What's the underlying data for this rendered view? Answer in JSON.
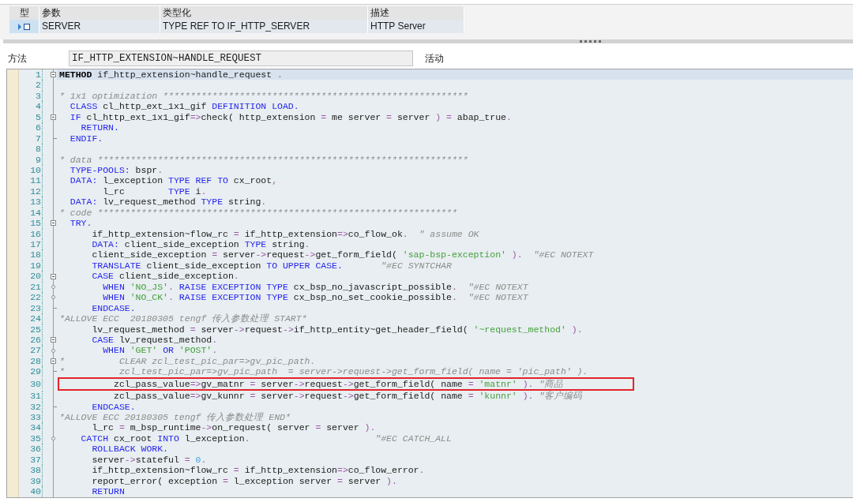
{
  "parameter_table": {
    "columns": [
      "型",
      "参数",
      "类型化",
      "描述"
    ],
    "rows": [
      {
        "parameter": "SERVER",
        "typing": "TYPE REF TO IF_HTTP_SERVER",
        "description": "HTTP Server"
      }
    ]
  },
  "method_bar": {
    "label": "方法",
    "value": "IF_HTTP_EXTENSION~HANDLE_REQUEST",
    "status": "活动"
  },
  "editor": {
    "lines": [
      {
        "number": "1",
        "kind": "opener",
        "selected": true,
        "boxed": false,
        "tokens": [
          {
            "kind": "bold",
            "text": "METHOD"
          },
          {
            "kind": "plain",
            "text": " if_http_extension~handle_request "
          },
          {
            "kind": "op",
            "text": "."
          }
        ]
      },
      {
        "number": "2",
        "kind": "line",
        "selected": false,
        "boxed": false
      },
      {
        "number": "3",
        "kind": "line",
        "selected": false,
        "boxed": false,
        "tokens": [
          {
            "kind": "comment",
            "text": "* 1x1 optimization ********************************************************"
          }
        ]
      },
      {
        "number": "4",
        "kind": "line",
        "selected": false,
        "boxed": false,
        "tokens": [
          {
            "kind": "keyword",
            "text": "  CLASS"
          },
          {
            "kind": "plain",
            "text": " cl_http_ext_1x1_gif "
          },
          {
            "kind": "keyword",
            "text": "DEFINITION LOAD."
          }
        ]
      },
      {
        "number": "5",
        "kind": "opener",
        "selected": false,
        "boxed": false,
        "tokens": [
          {
            "kind": "keyword",
            "text": "  IF"
          },
          {
            "kind": "plain",
            "text": " cl_http_ext_1x1_gif"
          },
          {
            "kind": "op",
            "text": "=>"
          },
          {
            "kind": "plain",
            "text": "check( http_extension "
          },
          {
            "kind": "op",
            "text": "="
          },
          {
            "kind": "plain",
            "text": " me server "
          },
          {
            "kind": "op",
            "text": "="
          },
          {
            "kind": "plain",
            "text": " server "
          },
          {
            "kind": "op",
            "text": ") ="
          },
          {
            "kind": "plain",
            "text": " abap_true"
          },
          {
            "kind": "op",
            "text": "."
          }
        ]
      },
      {
        "number": "6",
        "kind": "line",
        "selected": false,
        "boxed": false,
        "tokens": [
          {
            "kind": "keyword",
            "text": "    RETURN."
          }
        ]
      },
      {
        "number": "7",
        "kind": "closer",
        "selected": false,
        "boxed": false,
        "tokens": [
          {
            "kind": "keyword",
            "text": "  ENDIF."
          }
        ]
      },
      {
        "number": "8",
        "kind": "line",
        "selected": false,
        "boxed": false
      },
      {
        "number": "9",
        "kind": "line",
        "selected": false,
        "boxed": false,
        "tokens": [
          {
            "kind": "comment",
            "text": "* data ********************************************************************"
          }
        ]
      },
      {
        "number": "10",
        "kind": "line",
        "selected": false,
        "boxed": false,
        "tokens": [
          {
            "kind": "keyword",
            "text": "  TYPE-POOLS:"
          },
          {
            "kind": "plain",
            "text": " bspr"
          },
          {
            "kind": "op",
            "text": "."
          }
        ]
      },
      {
        "number": "11",
        "kind": "line",
        "selected": false,
        "boxed": false,
        "tokens": [
          {
            "kind": "keyword",
            "text": "  DATA:"
          },
          {
            "kind": "plain",
            "text": " l_exception "
          },
          {
            "kind": "keyword",
            "text": "TYPE REF TO"
          },
          {
            "kind": "plain",
            "text": " cx_root"
          },
          {
            "kind": "op",
            "text": ","
          }
        ]
      },
      {
        "number": "12",
        "kind": "line",
        "selected": false,
        "boxed": false,
        "tokens": [
          {
            "kind": "plain",
            "text": "        l_rc        "
          },
          {
            "kind": "keyword",
            "text": "TYPE"
          },
          {
            "kind": "plain",
            "text": " i"
          },
          {
            "kind": "op",
            "text": "."
          }
        ]
      },
      {
        "number": "13",
        "kind": "line",
        "selected": false,
        "boxed": false,
        "tokens": [
          {
            "kind": "keyword",
            "text": "  DATA:"
          },
          {
            "kind": "plain",
            "text": " lv_request_method "
          },
          {
            "kind": "keyword",
            "text": "TYPE"
          },
          {
            "kind": "plain",
            "text": " string"
          },
          {
            "kind": "op",
            "text": "."
          }
        ]
      },
      {
        "number": "14",
        "kind": "line",
        "selected": false,
        "boxed": false,
        "tokens": [
          {
            "kind": "comment",
            "text": "* code ******************************************************************"
          }
        ]
      },
      {
        "number": "15",
        "kind": "opener",
        "selected": false,
        "boxed": false,
        "tokens": [
          {
            "kind": "keyword",
            "text": "  TRY."
          }
        ]
      },
      {
        "number": "16",
        "kind": "line",
        "selected": false,
        "boxed": false,
        "tokens": [
          {
            "kind": "plain",
            "text": "      if_http_extension~flow_rc "
          },
          {
            "kind": "op",
            "text": "="
          },
          {
            "kind": "plain",
            "text": " if_http_extension"
          },
          {
            "kind": "op",
            "text": "=>"
          },
          {
            "kind": "plain",
            "text": "co_flow_ok"
          },
          {
            "kind": "op",
            "text": "."
          },
          {
            "kind": "comment",
            "text": "  \" assume OK"
          }
        ]
      },
      {
        "number": "17",
        "kind": "line",
        "selected": false,
        "boxed": false,
        "tokens": [
          {
            "kind": "keyword",
            "text": "      DATA:"
          },
          {
            "kind": "plain",
            "text": " client_side_exception "
          },
          {
            "kind": "keyword",
            "text": "TYPE"
          },
          {
            "kind": "plain",
            "text": " string"
          },
          {
            "kind": "op",
            "text": "."
          }
        ]
      },
      {
        "number": "18",
        "kind": "line",
        "selected": false,
        "boxed": false,
        "tokens": [
          {
            "kind": "plain",
            "text": "      client_side_exception "
          },
          {
            "kind": "op",
            "text": "="
          },
          {
            "kind": "plain",
            "text": " server"
          },
          {
            "kind": "op",
            "text": "->"
          },
          {
            "kind": "plain",
            "text": "request"
          },
          {
            "kind": "op",
            "text": "->"
          },
          {
            "kind": "plain",
            "text": "get_form_field( "
          },
          {
            "kind": "string",
            "text": "'sap-bsp-exception'"
          },
          {
            "kind": "op",
            "text": " )."
          },
          {
            "kind": "comment",
            "text": "  \"#EC NOTEXT"
          }
        ]
      },
      {
        "number": "19",
        "kind": "line",
        "selected": false,
        "boxed": false,
        "tokens": [
          {
            "kind": "keyword",
            "text": "      TRANSLATE"
          },
          {
            "kind": "plain",
            "text": " client_side_exception "
          },
          {
            "kind": "keyword",
            "text": "TO UPPER CASE."
          },
          {
            "kind": "comment",
            "text": "       \"#EC SYNTCHAR"
          }
        ]
      },
      {
        "number": "20",
        "kind": "opener",
        "selected": false,
        "boxed": false,
        "tokens": [
          {
            "kind": "keyword",
            "text": "      CASE"
          },
          {
            "kind": "plain",
            "text": " client_side_exception"
          },
          {
            "kind": "op",
            "text": "."
          }
        ]
      },
      {
        "number": "21",
        "kind": "branch",
        "selected": false,
        "boxed": false,
        "tokens": [
          {
            "kind": "keyword",
            "text": "        WHEN"
          },
          {
            "kind": "string",
            "text": " 'NO_JS'"
          },
          {
            "kind": "op",
            "text": "."
          },
          {
            "kind": "keyword",
            "text": " RAISE EXCEPTION TYPE"
          },
          {
            "kind": "plain",
            "text": " cx_bsp_no_javascript_possible"
          },
          {
            "kind": "op",
            "text": "."
          },
          {
            "kind": "comment",
            "text": "  \"#EC NOTEXT"
          }
        ]
      },
      {
        "number": "22",
        "kind": "branch",
        "selected": false,
        "boxed": false,
        "tokens": [
          {
            "kind": "keyword",
            "text": "        WHEN"
          },
          {
            "kind": "string",
            "text": " 'NO_CK'"
          },
          {
            "kind": "op",
            "text": "."
          },
          {
            "kind": "keyword",
            "text": " RAISE EXCEPTION TYPE"
          },
          {
            "kind": "plain",
            "text": " cx_bsp_no_set_cookie_possible"
          },
          {
            "kind": "op",
            "text": "."
          },
          {
            "kind": "comment",
            "text": "  \"#EC NOTEXT"
          }
        ]
      },
      {
        "number": "23",
        "kind": "closer",
        "selected": false,
        "boxed": false,
        "tokens": [
          {
            "kind": "keyword",
            "text": "      ENDCASE."
          }
        ]
      },
      {
        "number": "24",
        "kind": "line",
        "selected": false,
        "boxed": false,
        "tokens": [
          {
            "kind": "comment",
            "text": "*ALLOVE ECC  20180305 tengf 传入参数处理 START*"
          }
        ]
      },
      {
        "number": "25",
        "kind": "line",
        "selected": false,
        "boxed": false,
        "tokens": [
          {
            "kind": "plain",
            "text": "      lv_request_method "
          },
          {
            "kind": "op",
            "text": "="
          },
          {
            "kind": "plain",
            "text": " server"
          },
          {
            "kind": "op",
            "text": "->"
          },
          {
            "kind": "plain",
            "text": "request"
          },
          {
            "kind": "op",
            "text": "->"
          },
          {
            "kind": "plain",
            "text": "if_http_entity~get_header_field( "
          },
          {
            "kind": "string",
            "text": "'~request_method'"
          },
          {
            "kind": "op",
            "text": " )."
          }
        ]
      },
      {
        "number": "26",
        "kind": "opener",
        "selected": false,
        "boxed": false,
        "tokens": [
          {
            "kind": "keyword",
            "text": "      CASE"
          },
          {
            "kind": "plain",
            "text": " lv_request_method"
          },
          {
            "kind": "op",
            "text": "."
          }
        ]
      },
      {
        "number": "27",
        "kind": "branch",
        "selected": false,
        "boxed": false,
        "tokens": [
          {
            "kind": "keyword",
            "text": "        WHEN"
          },
          {
            "kind": "string",
            "text": " 'GET'"
          },
          {
            "kind": "keyword",
            "text": " OR"
          },
          {
            "kind": "string",
            "text": " 'POST'"
          },
          {
            "kind": "op",
            "text": "."
          }
        ]
      },
      {
        "number": "28",
        "kind": "opener",
        "selected": false,
        "boxed": false,
        "tokens": [
          {
            "kind": "comment",
            "text": "*          CLEAR zcl_test_pic_par=>gv_pic_path."
          }
        ]
      },
      {
        "number": "29",
        "kind": "closer",
        "selected": false,
        "boxed": false,
        "tokens": [
          {
            "kind": "comment",
            "text": "*          zcl_test_pic_par=>gv_pic_path  = server->request->get_form_field( name = 'pic_path' )."
          }
        ]
      },
      {
        "number": "30",
        "kind": "line",
        "selected": false,
        "boxed": true,
        "tokens": [
          {
            "kind": "plain",
            "text": "          zcl_pass_value"
          },
          {
            "kind": "op",
            "text": "=>"
          },
          {
            "kind": "plain",
            "text": "gv_matnr "
          },
          {
            "kind": "op",
            "text": "="
          },
          {
            "kind": "plain",
            "text": " server"
          },
          {
            "kind": "op",
            "text": "->"
          },
          {
            "kind": "plain",
            "text": "request"
          },
          {
            "kind": "op",
            "text": "->"
          },
          {
            "kind": "plain",
            "text": "get_form_field( name "
          },
          {
            "kind": "op",
            "text": "="
          },
          {
            "kind": "string",
            "text": " 'matnr'"
          },
          {
            "kind": "op",
            "text": " )."
          },
          {
            "kind": "comment",
            "text": " \"商品"
          }
        ]
      },
      {
        "number": "31",
        "kind": "line",
        "selected": false,
        "boxed": false,
        "tokens": [
          {
            "kind": "plain",
            "text": "          zcl_pass_value"
          },
          {
            "kind": "op",
            "text": "=>"
          },
          {
            "kind": "plain",
            "text": "gv_kunnr "
          },
          {
            "kind": "op",
            "text": "="
          },
          {
            "kind": "plain",
            "text": " server"
          },
          {
            "kind": "op",
            "text": "->"
          },
          {
            "kind": "plain",
            "text": "request"
          },
          {
            "kind": "op",
            "text": "->"
          },
          {
            "kind": "plain",
            "text": "get_form_field( name "
          },
          {
            "kind": "op",
            "text": "="
          },
          {
            "kind": "string",
            "text": " 'kunnr'"
          },
          {
            "kind": "op",
            "text": " )."
          },
          {
            "kind": "comment",
            "text": " \"客户编码"
          }
        ]
      },
      {
        "number": "32",
        "kind": "closer",
        "selected": false,
        "boxed": false,
        "tokens": [
          {
            "kind": "keyword",
            "text": "      ENDCASE."
          }
        ]
      },
      {
        "number": "33",
        "kind": "line",
        "selected": false,
        "boxed": false,
        "tokens": [
          {
            "kind": "comment",
            "text": "*ALLOVE ECC 20180305 tengf 传入参数处理 END*"
          }
        ]
      },
      {
        "number": "34",
        "kind": "line",
        "selected": false,
        "boxed": false,
        "tokens": [
          {
            "kind": "plain",
            "text": "      l_rc "
          },
          {
            "kind": "op",
            "text": "="
          },
          {
            "kind": "plain",
            "text": " m_bsp_runtime"
          },
          {
            "kind": "op",
            "text": "->"
          },
          {
            "kind": "plain",
            "text": "on_request( server "
          },
          {
            "kind": "op",
            "text": "="
          },
          {
            "kind": "plain",
            "text": " server "
          },
          {
            "kind": "op",
            "text": ")."
          }
        ]
      },
      {
        "number": "35",
        "kind": "branch",
        "selected": false,
        "boxed": false,
        "tokens": [
          {
            "kind": "keyword",
            "text": "    CATCH"
          },
          {
            "kind": "plain",
            "text": " cx_root "
          },
          {
            "kind": "keyword",
            "text": "INTO"
          },
          {
            "kind": "plain",
            "text": " l_exception"
          },
          {
            "kind": "op",
            "text": "."
          },
          {
            "kind": "comment",
            "text": "                       \"#EC CATCH_ALL"
          }
        ]
      },
      {
        "number": "36",
        "kind": "line",
        "selected": false,
        "boxed": false,
        "tokens": [
          {
            "kind": "keyword",
            "text": "      ROLLBACK WORK."
          }
        ]
      },
      {
        "number": "37",
        "kind": "line",
        "selected": false,
        "boxed": false,
        "tokens": [
          {
            "kind": "plain",
            "text": "      server"
          },
          {
            "kind": "op",
            "text": "->"
          },
          {
            "kind": "plain",
            "text": "stateful "
          },
          {
            "kind": "op",
            "text": "="
          },
          {
            "kind": "number",
            "text": " 0"
          },
          {
            "kind": "op",
            "text": "."
          }
        ]
      },
      {
        "number": "38",
        "kind": "line",
        "selected": false,
        "boxed": false,
        "tokens": [
          {
            "kind": "plain",
            "text": "      if_http_extension~flow_rc "
          },
          {
            "kind": "op",
            "text": "="
          },
          {
            "kind": "plain",
            "text": " if_http_extension"
          },
          {
            "kind": "op",
            "text": "=>"
          },
          {
            "kind": "plain",
            "text": "co_flow_error"
          },
          {
            "kind": "op",
            "text": "."
          }
        ]
      },
      {
        "number": "39",
        "kind": "line",
        "selected": false,
        "boxed": false,
        "tokens": [
          {
            "kind": "plain",
            "text": "      report_error( exception "
          },
          {
            "kind": "op",
            "text": "="
          },
          {
            "kind": "plain",
            "text": " l_exception server "
          },
          {
            "kind": "op",
            "text": "="
          },
          {
            "kind": "plain",
            "text": " server "
          },
          {
            "kind": "op",
            "text": ")."
          }
        ]
      },
      {
        "number": "40",
        "kind": "line",
        "selected": false,
        "boxed": false,
        "tokens": [
          {
            "kind": "keyword",
            "text": "      RETURN"
          }
        ]
      }
    ]
  }
}
